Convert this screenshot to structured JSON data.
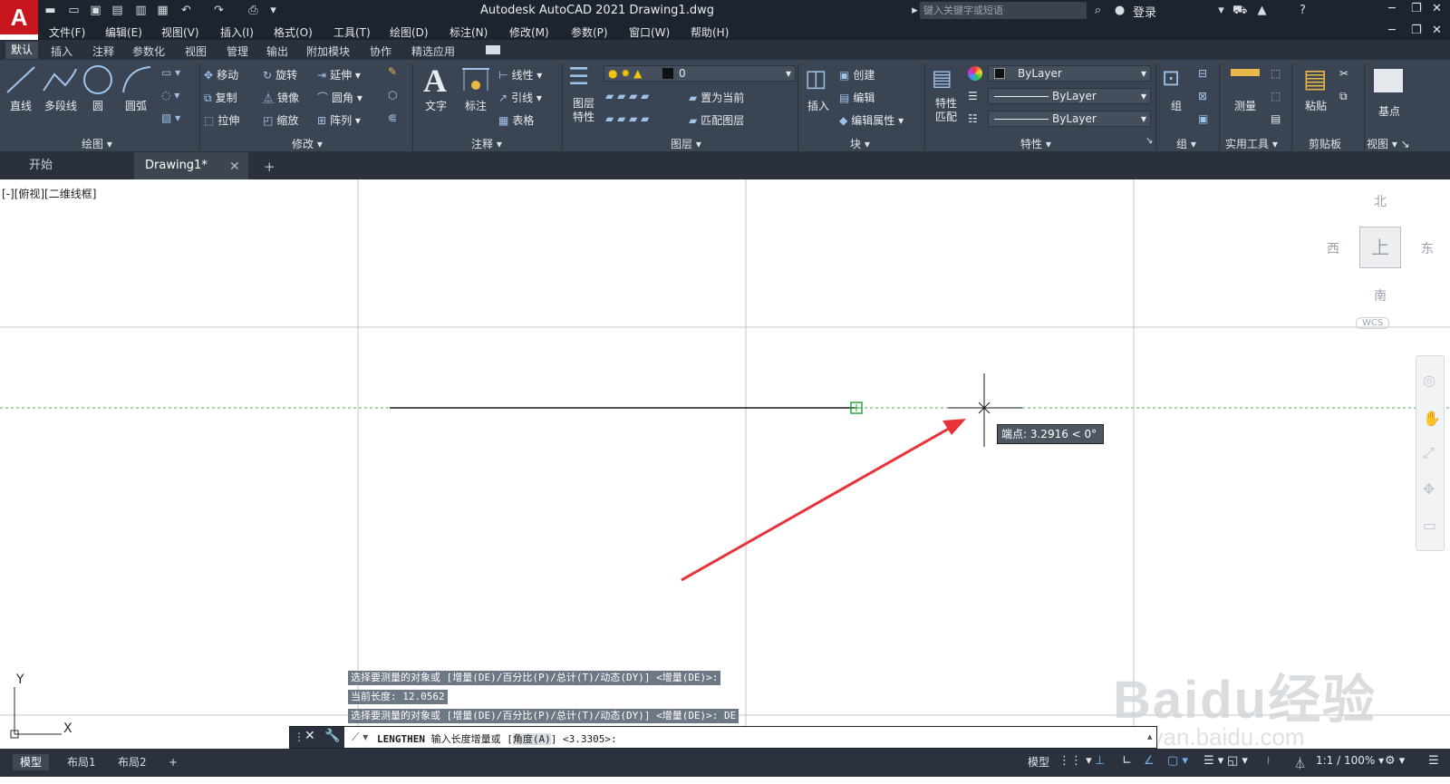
{
  "app": {
    "title": "Autodesk AutoCAD 2021    Drawing1.dwg",
    "logo": "A",
    "search_placeholder": "键入关键字或短语",
    "login": "登录"
  },
  "menu": [
    "文件(F)",
    "编辑(E)",
    "视图(V)",
    "插入(I)",
    "格式(O)",
    "工具(T)",
    "绘图(D)",
    "标注(N)",
    "修改(M)",
    "参数(P)",
    "窗口(W)",
    "帮助(H)"
  ],
  "ribbon_tabs": [
    "默认",
    "插入",
    "注释",
    "参数化",
    "视图",
    "管理",
    "输出",
    "附加模块",
    "协作",
    "精选应用"
  ],
  "ribbon": {
    "draw": {
      "line": "直线",
      "polyline": "多段线",
      "circle": "圆",
      "arc": "圆弧",
      "panel": "绘图"
    },
    "modify": {
      "move": "移动",
      "rotate": "旋转",
      "extend": "延伸",
      "copy": "复制",
      "mirror": "镜像",
      "fillet": "圆角",
      "stretch": "拉伸",
      "scale": "缩放",
      "array": "阵列",
      "panel": "修改"
    },
    "annotate": {
      "text": "文字",
      "dimension": "标注",
      "linear": "线性",
      "leader": "引线",
      "table": "表格",
      "panel": "注释"
    },
    "layers": {
      "properties": "图层\n特性",
      "layer_value": "0",
      "set_current": "置为当前",
      "match_layer": "匹配图层",
      "panel": "图层"
    },
    "block": {
      "insert": "插入",
      "create": "创建",
      "edit": "编辑",
      "edit_attr": "编辑属性",
      "panel": "块"
    },
    "properties": {
      "match": "特性\n匹配",
      "color": "ByLayer",
      "linetype": "ByLayer",
      "lineweight": "ByLayer",
      "panel": "特性"
    },
    "groups": {
      "group": "组",
      "panel": "组"
    },
    "utilities": {
      "measure": "测量",
      "panel": "实用工具"
    },
    "clipboard": {
      "paste": "粘贴",
      "panel": "剪贴板"
    },
    "view": {
      "base": "基点",
      "panel": "视图"
    }
  },
  "doc_tabs": {
    "start": "开始",
    "drawing": "Drawing1*"
  },
  "viewport": {
    "view_label": "[-][俯视][二维线框]",
    "compass": {
      "north": "北",
      "south": "南",
      "east": "东",
      "west": "西",
      "top": "上",
      "wcs": "WCS"
    },
    "tooltip": "端点: 3.2916 < 0°",
    "ucs_x": "X",
    "ucs_y": "Y"
  },
  "command": {
    "history": [
      "选择要测量的对象或 [增量(DE)/百分比(P)/总计(T)/动态(DY)] <增量(DE)>:",
      "当前长度: 12.0562",
      "选择要测量的对象或 [增量(DE)/百分比(P)/总计(T)/动态(DY)] <增量(DE)>: DE"
    ],
    "prompt_cmd": "LENGTHEN",
    "prompt_text": "输入长度增量或 [",
    "prompt_option": "角度(A)",
    "prompt_tail": "] <3.3305>:"
  },
  "status": {
    "model_tab": "模型",
    "layout1": "布局1",
    "layout2": "布局2",
    "model": "模型",
    "scale": "1:1 / 100%"
  },
  "watermark": {
    "logo": "Baidu经验",
    "url": "jingyan.baidu.com"
  },
  "colors": {
    "accent_red": "#e8323a",
    "ribbon_bg": "#3b4453",
    "arrow": "#e8323a"
  }
}
